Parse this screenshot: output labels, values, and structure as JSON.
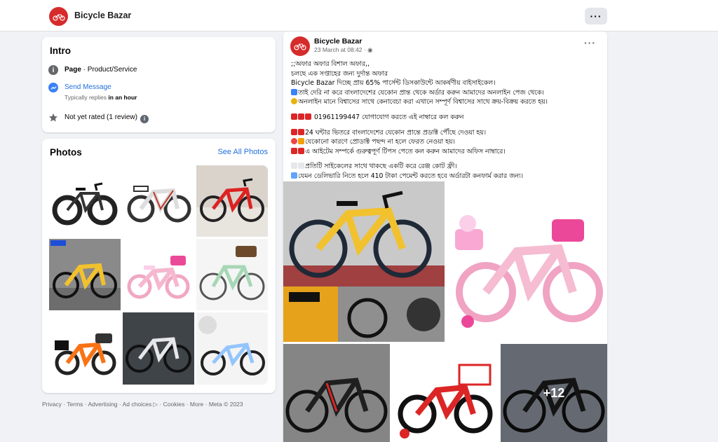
{
  "header": {
    "page_name": "Bicycle Bazar",
    "more_label": "···"
  },
  "intro": {
    "title": "Intro",
    "category_bold": "Page",
    "category_rest": " · Product/Service",
    "send_message": "Send Message",
    "reply_prefix": "Typically replies ",
    "reply_bold": "in an hour",
    "rating": "Not yet rated (1 review)",
    "info_glyph": "i"
  },
  "photos": {
    "title": "Photos",
    "see_all": "See All Photos"
  },
  "footer": {
    "text": "Privacy · Terms · Advertising · Ad choices ▷ · Cookies · More · Meta © 2023"
  },
  "post": {
    "author": "Bicycle Bazar",
    "time": "23 March at 08:42 · ◉",
    "more_label": "···",
    "lines": [
      ";;অফার অফার বিশাল অফার,,",
      "চলছে এক সপ্তাহের জন্য দুর্দান্ত অফার",
      "Bicycle Bazar দিচ্ছে প্রায় 65% পার্সেন্ট ডিসকাউন্টে আকর্ষণীয় বাইসাইকেল।",
      "তাই দেরি না করে বাংলাদেশের যেকোন প্রান্ত থেকে অর্ডার করুন আমাদের অনলাইন পেজ থেকে।",
      "অনলাইন মানে বিশ্বাসের সাথে কেনাবেচা করা এখানে সম্পূর্ণ বিশ্বাসের সাথে ক্রয়-বিক্রয় করতে হয়।",
      "01961199447 যোগাযোগ করতে এই নাম্বারে কল করুন",
      "24 ঘন্টার ভিতরে বাংলাদেশের যেকোন প্রান্তে প্রডাক্ট পৌঁছে দেওয়া হয়।",
      "যেকোনো কারণে প্রোডাক্ট পছন্দ না হলে ফেরত নেওয়া হয়।",
      "এ আইটেম সম্পর্কে গুরুত্বপূর্ণ টিপস পেতে কল করুন আমাদের অফিস নাম্বারে।",
      "প্রতিটি সাইকেলের সাথে থাকছে একটি করে রেঞ্জ কোট ফ্রী।",
      "যেমন ডেলিভারি নিতে হলে 410 টাকা পেমেন্ট করতে হবে অর্ডারটা কনফার্ম করার জন্য।"
    ],
    "more_photos_count": "+12"
  },
  "colors": {
    "brand_red": "#d62b2b",
    "link_blue": "#216fdb",
    "background": "#f0f2f5"
  }
}
